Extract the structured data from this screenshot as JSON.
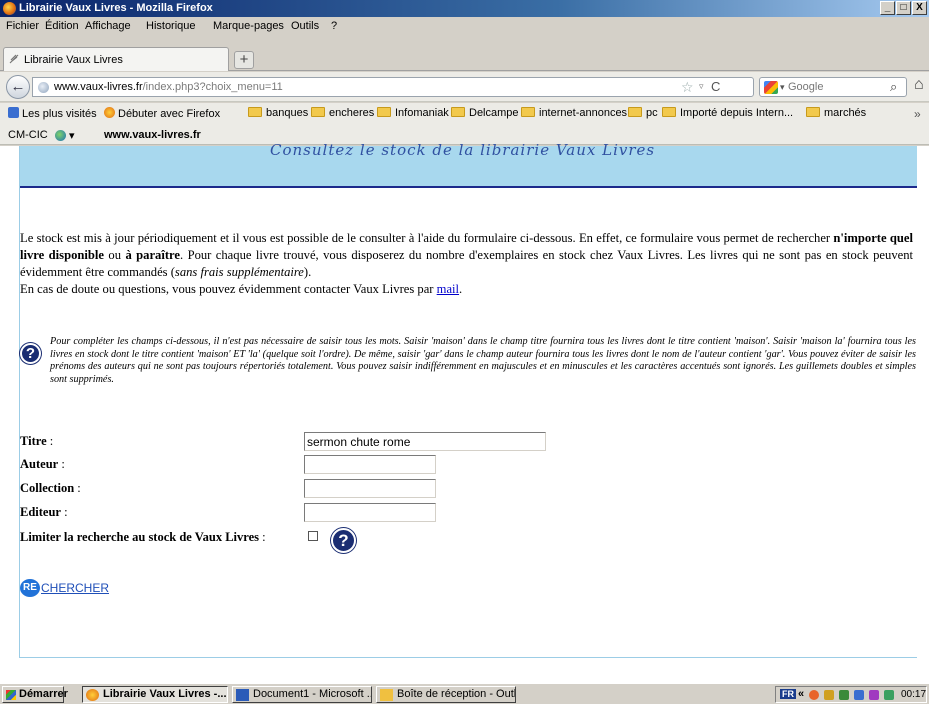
{
  "window": {
    "title": "Librairie Vaux Livres - Mozilla Firefox",
    "min": "_",
    "max": "□",
    "close": "X"
  },
  "menu": [
    "Fichier",
    "Édition",
    "Affichage",
    "Historique",
    "Marque-pages",
    "Outils",
    "?"
  ],
  "tab": {
    "label": "Librairie Vaux Livres",
    "new_tab": "+"
  },
  "nav": {
    "back": "←",
    "url_host": "www.vaux-livres.fr",
    "url_path": "/index.php3?choix_menu=11",
    "star": "☆",
    "dropdown": "▿",
    "reload": "C",
    "search_placeholder": "Google",
    "search_dropdown": "▾",
    "search_go": "⌕",
    "home": "⌂"
  },
  "bookmarks": [
    {
      "label": "Les plus visités",
      "icon": "list-icon"
    },
    {
      "label": "Débuter avec Firefox",
      "icon": "firefox-icon"
    },
    {
      "label": "banques",
      "icon": "folder-icon"
    },
    {
      "label": "encheres",
      "icon": "folder-icon"
    },
    {
      "label": "Infomaniak",
      "icon": "folder-icon"
    },
    {
      "label": "Delcampe",
      "icon": "folder-icon"
    },
    {
      "label": "internet-annonces",
      "icon": "folder-icon"
    },
    {
      "label": "pc",
      "icon": "folder-icon"
    },
    {
      "label": "Importé depuis Intern...",
      "icon": "folder-icon"
    },
    {
      "label": "marchés",
      "icon": "folder-icon"
    }
  ],
  "bookmarks_overflow": "»",
  "cmbar": {
    "label": "CM-CIC",
    "dropdown": "▾",
    "site": "www.vaux-livres.fr"
  },
  "banner": {
    "text": "Consultez le stock de la librairie Vaux Livres"
  },
  "intro": {
    "p1": "Le stock est mis à jour périodiquement et il vous est possible de le consulter à l'aide du formulaire ci-dessous. En effet, ce formulaire vous permet de rechercher ",
    "bold1": "n'importe quel livre disponible",
    "p2": " ou ",
    "bold2": "à paraître",
    "p3": ". Pour chaque livre trouvé, vous disposerez du nombre d'exemplaires en stock chez Vaux Livres. Les livres qui ne sont pas en stock peuvent évidemment être commandés (",
    "italic1": "sans frais supplémentaire",
    "p4": ").",
    "p5": "En cas de doute ou questions, vous pouvez évidemment contacter Vaux Livres par ",
    "mail": "mail",
    "p6": "."
  },
  "help_text": "Pour compléter les champs ci-dessous, il n'est pas nécessaire de saisir tous les mots. Saisir 'maison' dans le champ titre fournira tous les livres dont le titre contient 'maison'. Saisir 'maison la' fournira tous les livres en stock dont le titre contient 'maison' ET 'la' (quelque soit l'ordre). De même, saisir 'gar' dans le champ auteur fournira tous les livres dont le nom de l'auteur contient 'gar'. Vous pouvez éviter de saisir les prénoms des auteurs qui ne sont pas toujours répertoriés totalement. Vous pouvez saisir indifféremment en majuscules et en minuscules et les caractères accentués sont ignorés. Les guillemets doubles et simples sont supprimés.",
  "help_glyph": "?",
  "form": {
    "titre_label": "Titre",
    "titre_value": "sermon chute rome",
    "auteur_label": "Auteur",
    "auteur_value": "",
    "collection_label": "Collection",
    "collection_value": "",
    "editeur_label": "Editeur",
    "editeur_value": "",
    "colon": " :",
    "limit_label": "Limiter la recherche au stock de Vaux Livres",
    "search_re": "RE",
    "search_rest": "CHERCHER"
  },
  "taskbar": {
    "start": "Démarrer",
    "items": [
      "Librairie Vaux Livres -...",
      "Document1 - Microsoft ...",
      "Boîte de réception - Outl..."
    ],
    "lang": "FR",
    "chevron": "«",
    "time": "00:17"
  }
}
